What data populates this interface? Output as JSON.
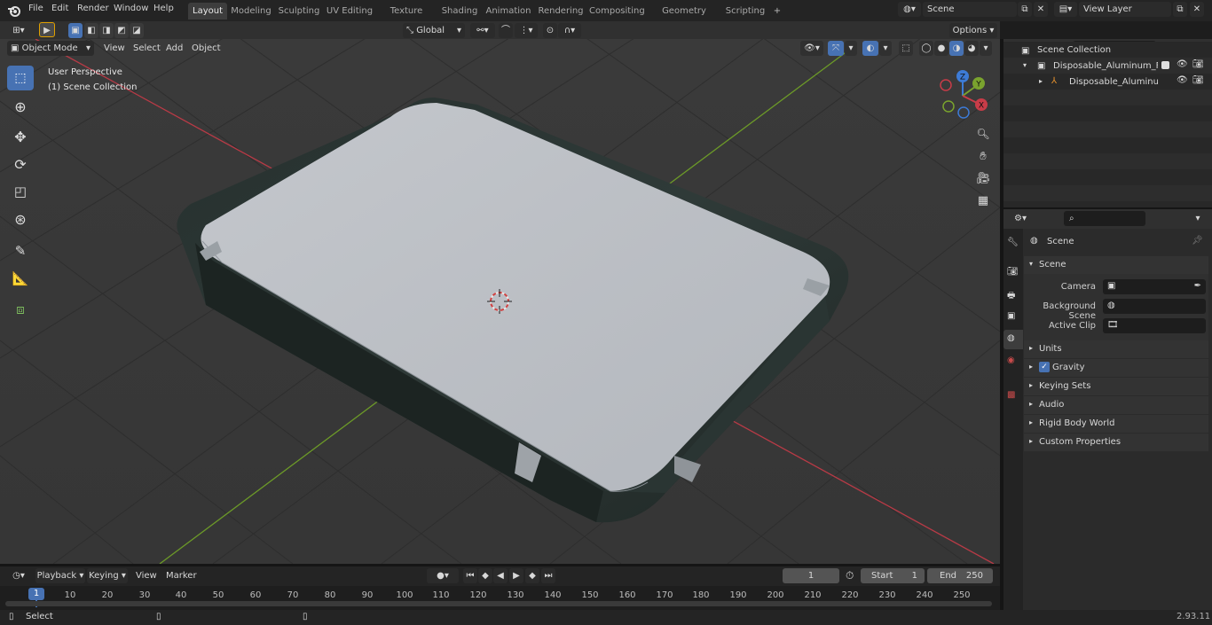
{
  "menu": {
    "file": "File",
    "edit": "Edit",
    "render": "Render",
    "window": "Window",
    "help": "Help"
  },
  "workspaces": [
    "Layout",
    "Modeling",
    "Sculpting",
    "UV Editing",
    "Texture Paint",
    "Shading",
    "Animation",
    "Rendering",
    "Compositing",
    "Geometry Nodes",
    "Scripting"
  ],
  "add_tab": "+",
  "scene_selector": {
    "value": "Scene"
  },
  "view_layer": {
    "value": "View Layer"
  },
  "toolbar": {
    "transform_orientation": "Global",
    "options": "Options"
  },
  "viewport_header": {
    "mode": "Object Mode",
    "view": "View",
    "select": "Select",
    "add": "Add",
    "object": "Object"
  },
  "viewport": {
    "perspective": "User Perspective",
    "collection": "(1) Scene Collection"
  },
  "gizmo": {
    "z": "Z",
    "y": "Y",
    "x": "X"
  },
  "outliner": {
    "scene_collection": "Scene Collection",
    "rows": [
      {
        "label": "Disposable_Aluminum_Foil_Fr"
      },
      {
        "label": "Disposable_Aluminum_Fo"
      }
    ]
  },
  "properties": {
    "context": "Scene",
    "panel_title": "Scene",
    "camera_label": "Camera",
    "background_label": "Background Scene",
    "clip_label": "Active Clip",
    "sections": [
      "Units",
      "Gravity",
      "Keying Sets",
      "Audio",
      "Rigid Body World",
      "Custom Properties"
    ]
  },
  "timeline": {
    "playback": "Playback",
    "keying": "Keying",
    "view": "View",
    "marker": "Marker",
    "current_frame": "1",
    "start_label": "Start",
    "start": "1",
    "end_label": "End",
    "end": "250",
    "playhead": "1",
    "ticks": [
      "10",
      "20",
      "30",
      "40",
      "50",
      "60",
      "70",
      "80",
      "90",
      "100",
      "110",
      "120",
      "130",
      "140",
      "150",
      "160",
      "170",
      "180",
      "190",
      "200",
      "210",
      "220",
      "230",
      "240",
      "250"
    ]
  },
  "status": {
    "select": "Select",
    "version": "2.93.11"
  },
  "colors": {
    "accent": "#4772b3",
    "active_tab": "#3d3d3d",
    "x_axis": "#c83c48",
    "y_axis": "#7aa32e",
    "z_axis": "#3d7bd6"
  }
}
